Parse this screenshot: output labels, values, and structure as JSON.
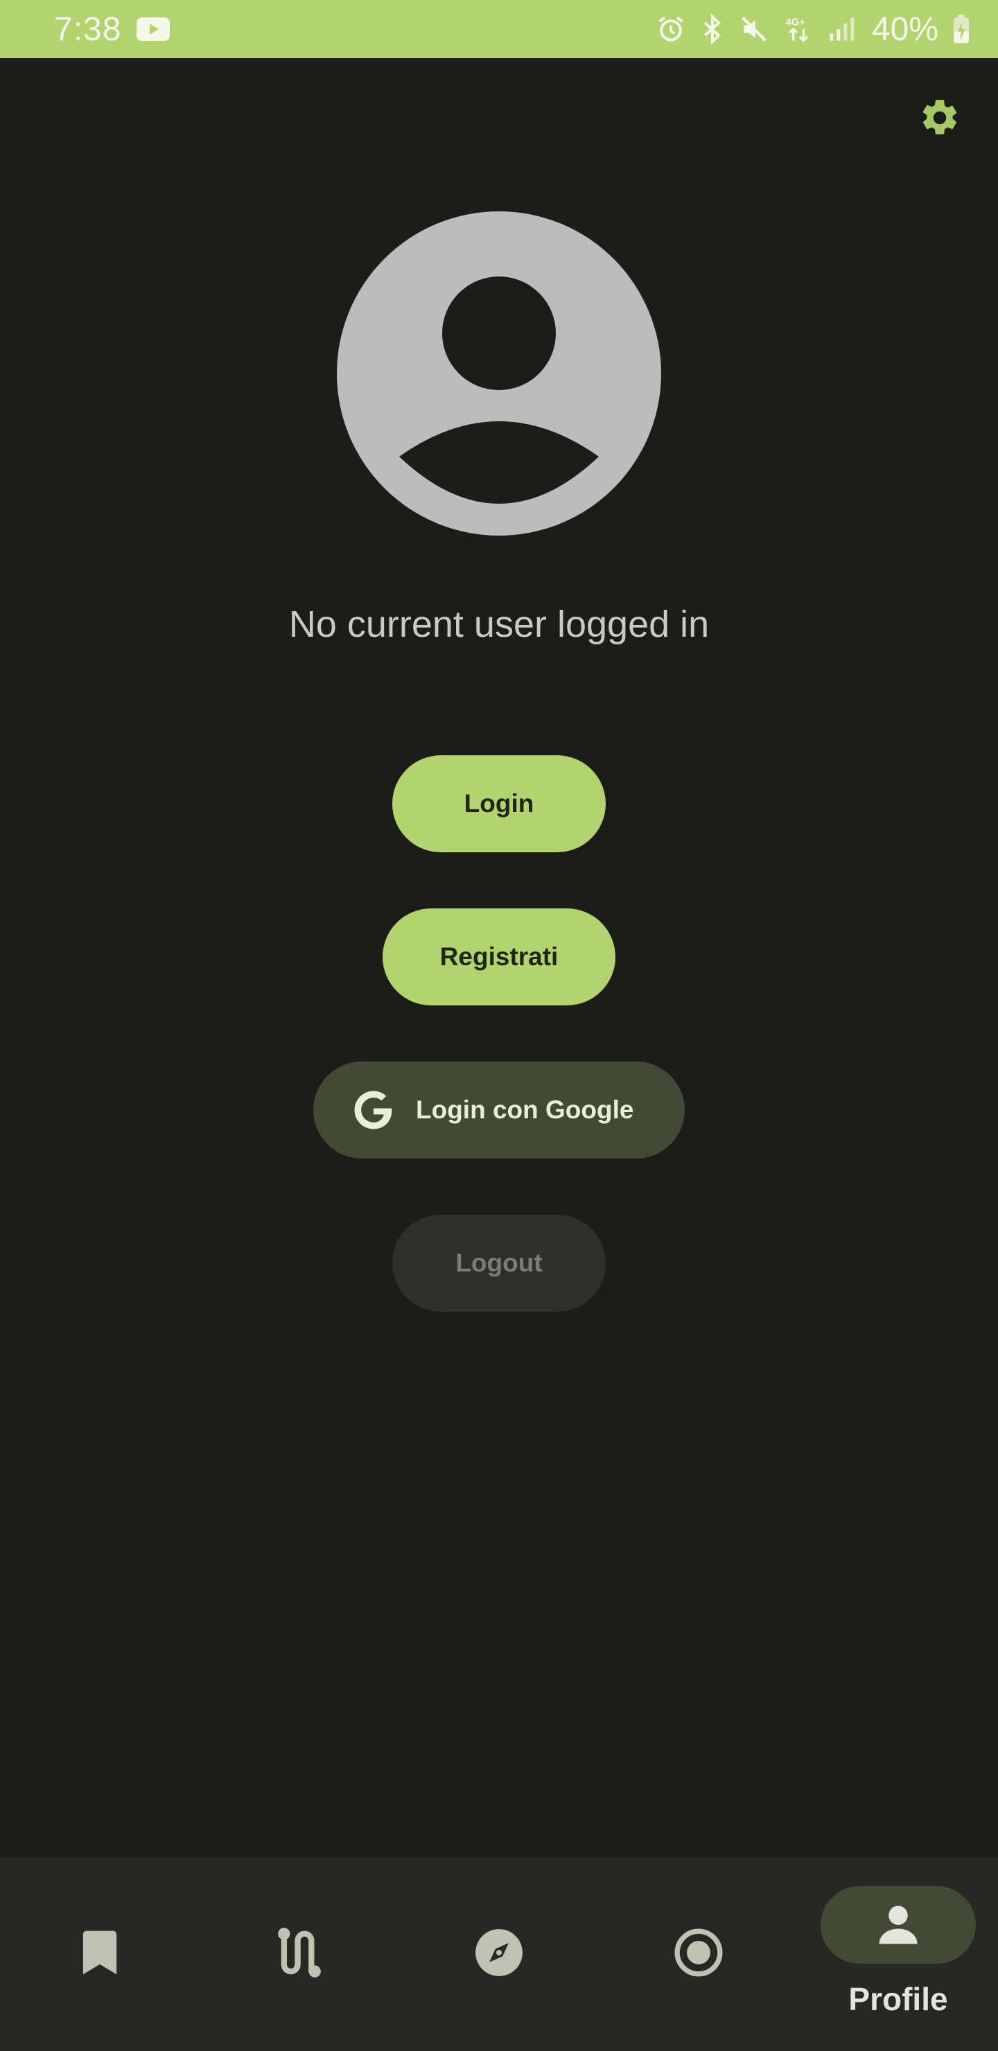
{
  "status_bar": {
    "time": "7:38",
    "battery": "40%",
    "icons": [
      "youtube-icon",
      "alarm-icon",
      "bluetooth-icon",
      "mute-icon",
      "network-4g-icon",
      "signal-icon",
      "battery-charging-icon"
    ]
  },
  "profile": {
    "message": "No current user logged in"
  },
  "buttons": {
    "login": "Login",
    "register": "Registrati",
    "google_login": "Login con Google",
    "logout": "Logout"
  },
  "bottom_nav": {
    "items": [
      {
        "icon": "bookmark-icon"
      },
      {
        "icon": "route-icon"
      },
      {
        "icon": "compass-icon"
      },
      {
        "icon": "record-icon"
      },
      {
        "icon": "person-icon",
        "label": "Profile",
        "selected": true
      }
    ]
  },
  "colors": {
    "accent": "#b3d36f",
    "background": "#1c1c19",
    "nav_background": "#262822",
    "google_button": "#414a33",
    "logout_disabled": "#2f302c",
    "avatar": "#bcbcbc"
  }
}
